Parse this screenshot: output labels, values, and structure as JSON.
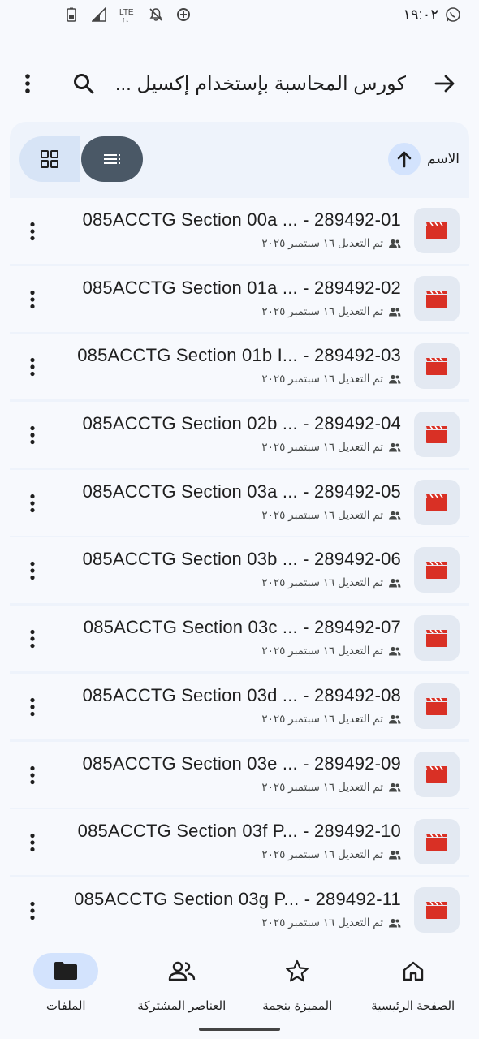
{
  "status_bar": {
    "time": "١٩:٠٢",
    "network": "LTE"
  },
  "header": {
    "title": "كورس المحاسبة بإستخدام إكسيل ..."
  },
  "toolbar": {
    "sort_label": "الاسم"
  },
  "files": [
    {
      "name": "085ACCTG Section 00a ... - 289492-01",
      "meta": "تم التعديل ١٦ سبتمبر ٢٠٢٥"
    },
    {
      "name": "085ACCTG Section 01a ... - 289492-02",
      "meta": "تم التعديل ١٦ سبتمبر ٢٠٢٥"
    },
    {
      "name": "085ACCTG Section 01b I... - 289492-03",
      "meta": "تم التعديل ١٦ سبتمبر ٢٠٢٥"
    },
    {
      "name": "085ACCTG Section 02b ... - 289492-04",
      "meta": "تم التعديل ١٦ سبتمبر ٢٠٢٥"
    },
    {
      "name": "085ACCTG Section 03a ... - 289492-05",
      "meta": "تم التعديل ١٦ سبتمبر ٢٠٢٥"
    },
    {
      "name": "085ACCTG Section 03b ... - 289492-06",
      "meta": "تم التعديل ١٦ سبتمبر ٢٠٢٥"
    },
    {
      "name": "085ACCTG Section 03c ... - 289492-07",
      "meta": "تم التعديل ١٦ سبتمبر ٢٠٢٥"
    },
    {
      "name": "085ACCTG Section 03d ... - 289492-08",
      "meta": "تم التعديل ١٦ سبتمبر ٢٠٢٥"
    },
    {
      "name": "085ACCTG Section 03e ... - 289492-09",
      "meta": "تم التعديل ١٦ سبتمبر ٢٠٢٥"
    },
    {
      "name": "085ACCTG Section 03f P... - 289492-10",
      "meta": "تم التعديل ١٦ سبتمبر ٢٠٢٥"
    },
    {
      "name": "085ACCTG Section 03g P... - 289492-11",
      "meta": "تم التعديل ١٦ سبتمبر ٢٠٢٥"
    }
  ],
  "bottom_nav": {
    "files_label": "الملفات",
    "shared_label": "العناصر المشتركة",
    "starred_label": "المميزة بنجمة",
    "home_label": "الصفحة الرئيسية"
  },
  "colors": {
    "video_icon": "#d93025",
    "active_nav": "#d3e3fd",
    "list_toggle": "#4a5866"
  }
}
